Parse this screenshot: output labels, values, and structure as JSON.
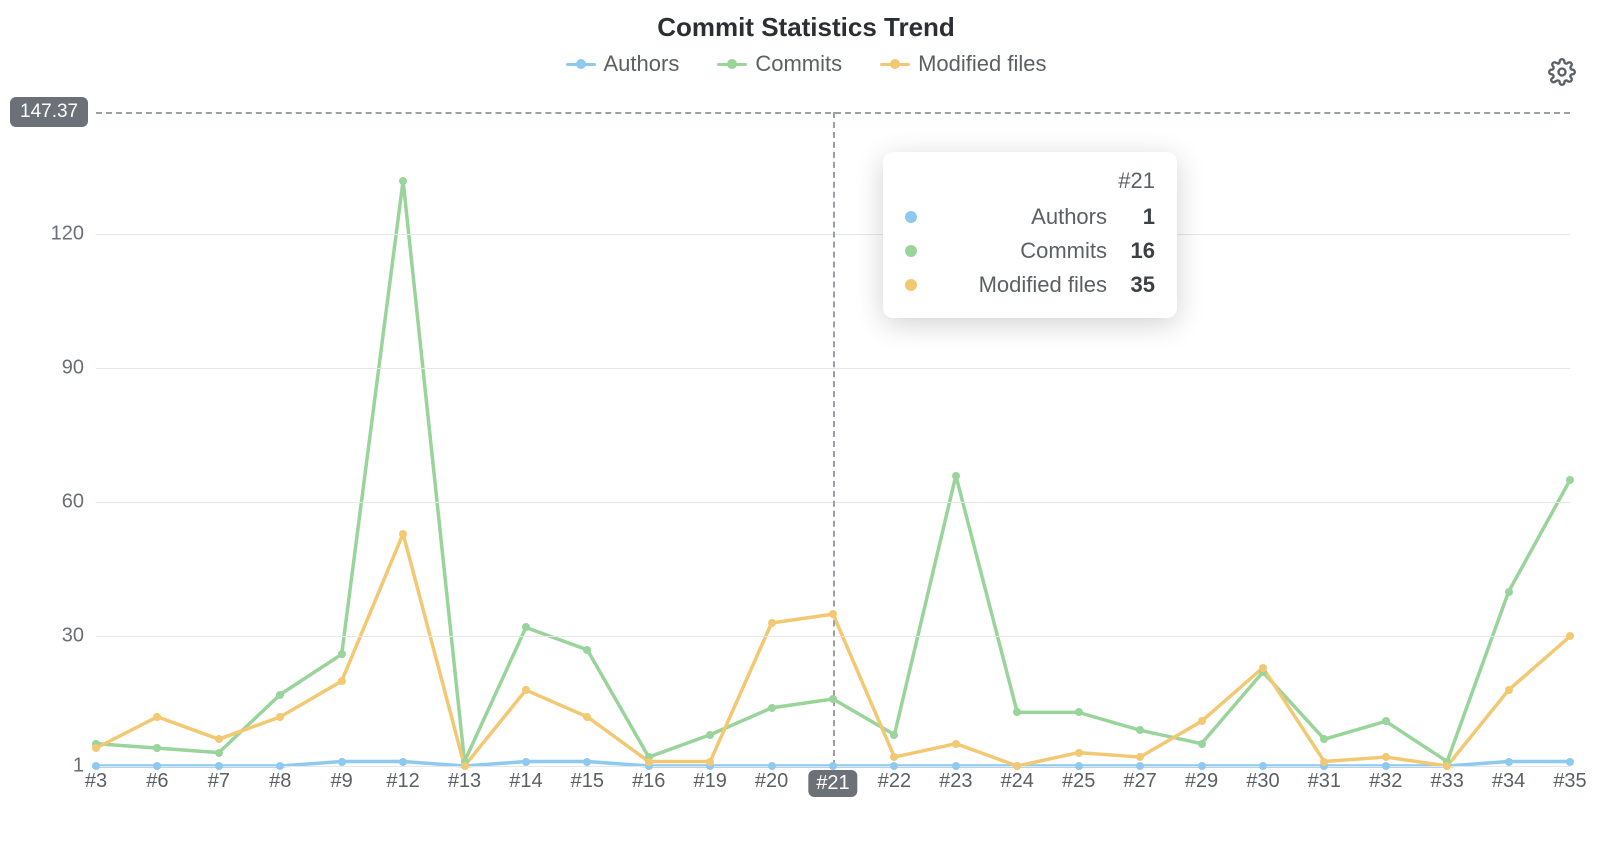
{
  "title": "Commit Statistics Trend",
  "legend": [
    {
      "key": "authors",
      "label": "Authors",
      "color": "#8ec9ef"
    },
    {
      "key": "commits",
      "label": "Commits",
      "color": "#99d49b"
    },
    {
      "key": "modified",
      "label": "Modified files",
      "color": "#f3c873"
    }
  ],
  "mean_label": "147.37",
  "gear_icon": "gear-icon",
  "tooltip": {
    "category": "#21",
    "rows": [
      {
        "key": "authors",
        "label": "Authors",
        "value": "1",
        "color": "#8ec9ef"
      },
      {
        "key": "commits",
        "label": "Commits",
        "value": "16",
        "color": "#99d49b"
      },
      {
        "key": "modified",
        "label": "Modified files",
        "value": "35",
        "color": "#f3c873"
      }
    ]
  },
  "chart_data": {
    "type": "line",
    "title": "Commit Statistics Trend",
    "xlabel": "",
    "ylabel": "",
    "ylim": [
      1,
      147.37
    ],
    "y_ticks": [
      1,
      30,
      60,
      90,
      120
    ],
    "mean_line": 147.37,
    "categories": [
      "#3",
      "#6",
      "#7",
      "#8",
      "#9",
      "#12",
      "#13",
      "#14",
      "#15",
      "#16",
      "#19",
      "#20",
      "#21",
      "#22",
      "#23",
      "#24",
      "#25",
      "#27",
      "#29",
      "#30",
      "#31",
      "#32",
      "#33",
      "#34",
      "#35"
    ],
    "active_category": "#21",
    "series": [
      {
        "name": "Authors",
        "color": "#8ec9ef",
        "values": [
          1,
          1,
          1,
          1,
          2,
          2,
          1,
          2,
          2,
          1,
          1,
          1,
          1,
          1,
          1,
          1,
          1,
          1,
          1,
          1,
          1,
          1,
          1,
          2,
          2
        ]
      },
      {
        "name": "Commits",
        "color": "#99d49b",
        "values": [
          6,
          5,
          4,
          17,
          26,
          132,
          2,
          32,
          27,
          3,
          8,
          14,
          16,
          8,
          66,
          13,
          13,
          9,
          6,
          22,
          7,
          11,
          2,
          40,
          65
        ]
      },
      {
        "name": "Modified files",
        "color": "#f3c873",
        "values": [
          5,
          12,
          7,
          12,
          20,
          53,
          1,
          18,
          12,
          2,
          2,
          33,
          35,
          3,
          6,
          1,
          4,
          3,
          11,
          23,
          2,
          3,
          1,
          18,
          30
        ]
      }
    ],
    "legend_position": "top",
    "grid": true
  }
}
